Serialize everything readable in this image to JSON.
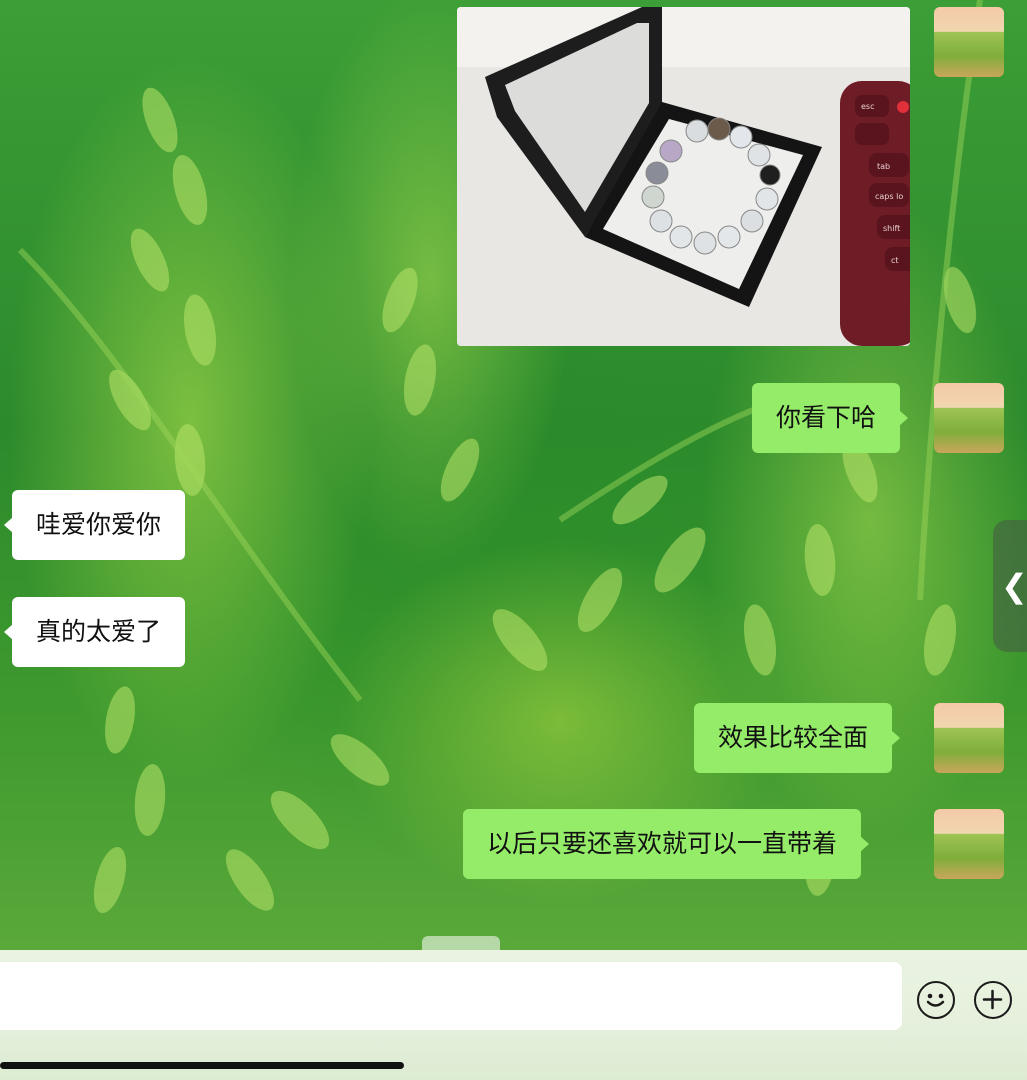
{
  "chat": {
    "messages": [
      {
        "id": 1,
        "side": "out",
        "kind": "image",
        "image_desc": "bracelet-in-display-box-photo"
      },
      {
        "id": 2,
        "side": "out",
        "kind": "text",
        "text": "你看下哈"
      },
      {
        "id": 3,
        "side": "in",
        "kind": "text",
        "text": "哇爱你爱你"
      },
      {
        "id": 4,
        "side": "in",
        "kind": "text",
        "text": "真的太爱了"
      },
      {
        "id": 5,
        "side": "out",
        "kind": "text",
        "text": "效果比较全面"
      },
      {
        "id": 6,
        "side": "out",
        "kind": "text",
        "text": "以后只要还喜欢就可以一直带着"
      }
    ]
  },
  "image_photo": {
    "keyboard_keys": [
      "esc",
      "tab",
      "caps lo",
      "shift",
      "ct"
    ]
  },
  "side_handle": {
    "glyph": "❮"
  },
  "input_bar": {
    "value": "",
    "emoji_icon": "emoji-icon",
    "plus_icon": "plus-icon"
  },
  "colors": {
    "outgoing_bubble": "#95ec69",
    "incoming_bubble": "#ffffff",
    "input_bar_bg": "#e5f0dc"
  }
}
